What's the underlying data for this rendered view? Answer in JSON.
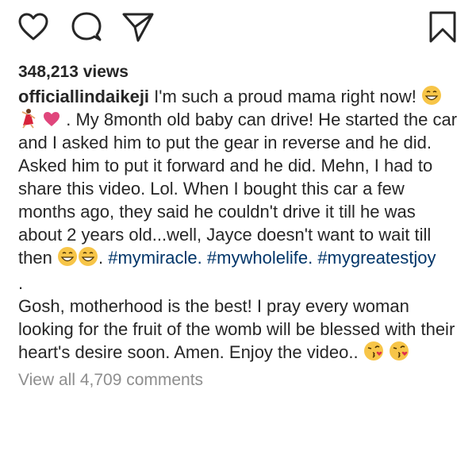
{
  "actions": {
    "like_icon": "heart-outline",
    "comment_icon": "speech-bubble-outline",
    "share_icon": "paper-plane-outline",
    "save_icon": "bookmark-outline"
  },
  "post": {
    "views": "348,213 views",
    "username": "officiallindaikeji",
    "caption_intro": "I'm such a proud mama right now!",
    "caption_body": ". My 8month old baby can drive! He started the car and I asked him to put the gear in reverse and he did. Asked him to put it forward and he did. Mehn, I had to share this video. Lol. When I bought this car a few months ago, they said he couldn't drive it till he was about 2 years old...well, Jayce doesn't want to wait till then",
    "caption_after": ".",
    "hashtags": [
      "#mymiracle.",
      "#mywholelife.",
      "#mygreatestjoy"
    ],
    "separator": ".",
    "paragraph2": "Gosh, motherhood is the best! I pray every woman looking for the fruit of the womb will be blessed with their heart's desire soon. Amen. Enjoy the video..",
    "view_comments": "View all 4,709 comments"
  }
}
